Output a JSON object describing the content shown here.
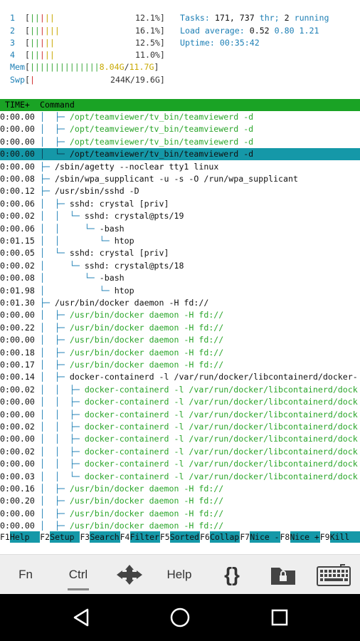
{
  "meters": {
    "cpus": [
      {
        "idx": "1",
        "bars_green": "||",
        "bars_red": "|",
        "bars_yellow": "",
        "extra": "||",
        "pct": "12.1%"
      },
      {
        "idx": "2",
        "bars_green": "||",
        "bars_red": "|",
        "bars_yellow": "",
        "extra": "|||",
        "pct": "16.1%"
      },
      {
        "idx": "3",
        "bars_green": "||",
        "bars_red": "|",
        "bars_yellow": "",
        "extra": "||",
        "pct": "12.5%"
      },
      {
        "idx": "4",
        "bars_green": "||",
        "bars_red": "|",
        "bars_yellow": "",
        "extra": "||",
        "pct": "11.0%"
      }
    ],
    "cpu_lines": [
      "12.1%]",
      "16.1%]",
      "12.5%]",
      "11.0%]"
    ],
    "mem": {
      "label": "Mem",
      "used": "8.04G",
      "total": "11.7G"
    },
    "swp": {
      "label": "Swp",
      "value": "244K/19.6G"
    }
  },
  "stats": {
    "tasks_label": "Tasks:",
    "tasks": "171,",
    "threads": "737",
    "thr_label": "thr;",
    "running": "2",
    "running_label": "running",
    "load_label": "Load average:",
    "load1": "0.52",
    "load5": "0.80",
    "load15": "1.21",
    "uptime_label": "Uptime:",
    "uptime": "00:35:42"
  },
  "header": {
    "time": "TIME+",
    "command": "Command"
  },
  "rows": [
    {
      "time": "0:00.00",
      "tree": "│  ├─ ",
      "cmd": "/opt/teamviewer/tv_bin/teamviewerd -d",
      "green": true
    },
    {
      "time": "0:00.00",
      "tree": "│  ├─ ",
      "cmd": "/opt/teamviewer/tv_bin/teamviewerd -d",
      "green": true
    },
    {
      "time": "0:00.00",
      "tree": "│  ├─ ",
      "cmd": "/opt/teamviewer/tv_bin/teamviewerd -d",
      "green": true
    },
    {
      "time": "0:00.00",
      "tree": "│  └─ ",
      "cmd": "/opt/teamviewer/tv_bin/teamviewerd -d",
      "green": true,
      "selected": true
    },
    {
      "time": "0:00.00",
      "tree": "├─ ",
      "cmd": "/sbin/agetty --noclear tty1 linux",
      "green": false
    },
    {
      "time": "0:00.08",
      "tree": "├─ ",
      "cmd": "/sbin/wpa_supplicant -u -s -O /run/wpa_supplicant",
      "green": false
    },
    {
      "time": "0:00.12",
      "tree": "├─ ",
      "cmd": "/usr/sbin/sshd -D",
      "green": false
    },
    {
      "time": "0:00.06",
      "tree": "│  ├─ ",
      "cmd": "sshd: crystal [priv]",
      "green": false
    },
    {
      "time": "0:00.02",
      "tree": "│  │  └─ ",
      "cmd": "sshd: crystal@pts/19",
      "green": false
    },
    {
      "time": "0:00.06",
      "tree": "│  │     └─ ",
      "cmd": "-bash",
      "green": false
    },
    {
      "time": "0:01.15",
      "tree": "│  │        └─ ",
      "cmd": "htop",
      "green": false
    },
    {
      "time": "0:00.05",
      "tree": "│  └─ ",
      "cmd": "sshd: crystal [priv]",
      "green": false
    },
    {
      "time": "0:00.02",
      "tree": "│     └─ ",
      "cmd": "sshd: crystal@pts/18",
      "green": false
    },
    {
      "time": "0:00.08",
      "tree": "│        └─ ",
      "cmd": "-bash",
      "green": false
    },
    {
      "time": "0:01.98",
      "tree": "│           └─ ",
      "cmd": "htop",
      "green": false
    },
    {
      "time": "0:01.30",
      "tree": "├─ ",
      "cmd": "/usr/bin/docker daemon -H fd://",
      "green": false
    },
    {
      "time": "0:00.00",
      "tree": "│  ├─ ",
      "cmd": "/usr/bin/docker daemon -H fd://",
      "green": true
    },
    {
      "time": "0:00.22",
      "tree": "│  ├─ ",
      "cmd": "/usr/bin/docker daemon -H fd://",
      "green": true
    },
    {
      "time": "0:00.00",
      "tree": "│  ├─ ",
      "cmd": "/usr/bin/docker daemon -H fd://",
      "green": true
    },
    {
      "time": "0:00.18",
      "tree": "│  ├─ ",
      "cmd": "/usr/bin/docker daemon -H fd://",
      "green": true
    },
    {
      "time": "0:00.17",
      "tree": "│  ├─ ",
      "cmd": "/usr/bin/docker daemon -H fd://",
      "green": true
    },
    {
      "time": "0:00.14",
      "tree": "│  ├─ ",
      "cmd": "docker-containerd -l /var/run/docker/libcontainerd/docker-",
      "green": false
    },
    {
      "time": "0:00.02",
      "tree": "│  │  ├─ ",
      "cmd": "docker-containerd -l /var/run/docker/libcontainerd/dock",
      "green": true
    },
    {
      "time": "0:00.00",
      "tree": "│  │  ├─ ",
      "cmd": "docker-containerd -l /var/run/docker/libcontainerd/dock",
      "green": true
    },
    {
      "time": "0:00.00",
      "tree": "│  │  ├─ ",
      "cmd": "docker-containerd -l /var/run/docker/libcontainerd/dock",
      "green": true
    },
    {
      "time": "0:00.02",
      "tree": "│  │  ├─ ",
      "cmd": "docker-containerd -l /var/run/docker/libcontainerd/dock",
      "green": true
    },
    {
      "time": "0:00.00",
      "tree": "│  │  ├─ ",
      "cmd": "docker-containerd -l /var/run/docker/libcontainerd/dock",
      "green": true
    },
    {
      "time": "0:00.02",
      "tree": "│  │  ├─ ",
      "cmd": "docker-containerd -l /var/run/docker/libcontainerd/dock",
      "green": true
    },
    {
      "time": "0:00.00",
      "tree": "│  │  ├─ ",
      "cmd": "docker-containerd -l /var/run/docker/libcontainerd/dock",
      "green": true
    },
    {
      "time": "0:00.03",
      "tree": "│  │  └─ ",
      "cmd": "docker-containerd -l /var/run/docker/libcontainerd/dock",
      "green": true
    },
    {
      "time": "0:00.16",
      "tree": "│  ├─ ",
      "cmd": "/usr/bin/docker daemon -H fd://",
      "green": true
    },
    {
      "time": "0:00.20",
      "tree": "│  ├─ ",
      "cmd": "/usr/bin/docker daemon -H fd://",
      "green": true
    },
    {
      "time": "0:00.00",
      "tree": "│  ├─ ",
      "cmd": "/usr/bin/docker daemon -H fd://",
      "green": true
    },
    {
      "time": "0:00.00",
      "tree": "│  ├─ ",
      "cmd": "/usr/bin/docker daemon -H fd://",
      "green": true
    }
  ],
  "fkeys": [
    {
      "key": "F1",
      "label": "Help  "
    },
    {
      "key": "F2",
      "label": "Setup "
    },
    {
      "key": "F3",
      "label": "Search"
    },
    {
      "key": "F4",
      "label": "Filter"
    },
    {
      "key": "F5",
      "label": "Sorted"
    },
    {
      "key": "F6",
      "label": "Collap"
    },
    {
      "key": "F7",
      "label": "Nice -"
    },
    {
      "key": "F8",
      "label": "Nice +"
    },
    {
      "key": "F9",
      "label": "Kill  "
    }
  ],
  "toolbar": {
    "fn": "Fn",
    "ctrl": "Ctrl",
    "arrows_icon": "arrows-move-icon",
    "help": "Help",
    "braces": "{}",
    "folder_icon": "folder-lock-icon",
    "keyboard_icon": "keyboard-icon"
  },
  "navbar": {
    "back_icon": "back-icon",
    "home_icon": "home-icon",
    "recents_icon": "recents-icon"
  },
  "colors": {
    "header_bg": "#1aa325",
    "selection_bg": "#1598a8",
    "tree_blue": "#1d7fb5",
    "proc_green": "#2aa52a"
  }
}
